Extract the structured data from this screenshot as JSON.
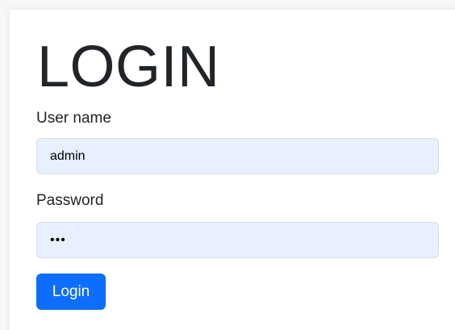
{
  "login": {
    "title": "LOGIN",
    "username_label": "User name",
    "username_value": "admin",
    "password_label": "Password",
    "password_value": "abc",
    "submit_label": "Login"
  },
  "colors": {
    "accent": "#0d6efd",
    "input_fill": "#e8f0fe",
    "text": "#212529"
  }
}
